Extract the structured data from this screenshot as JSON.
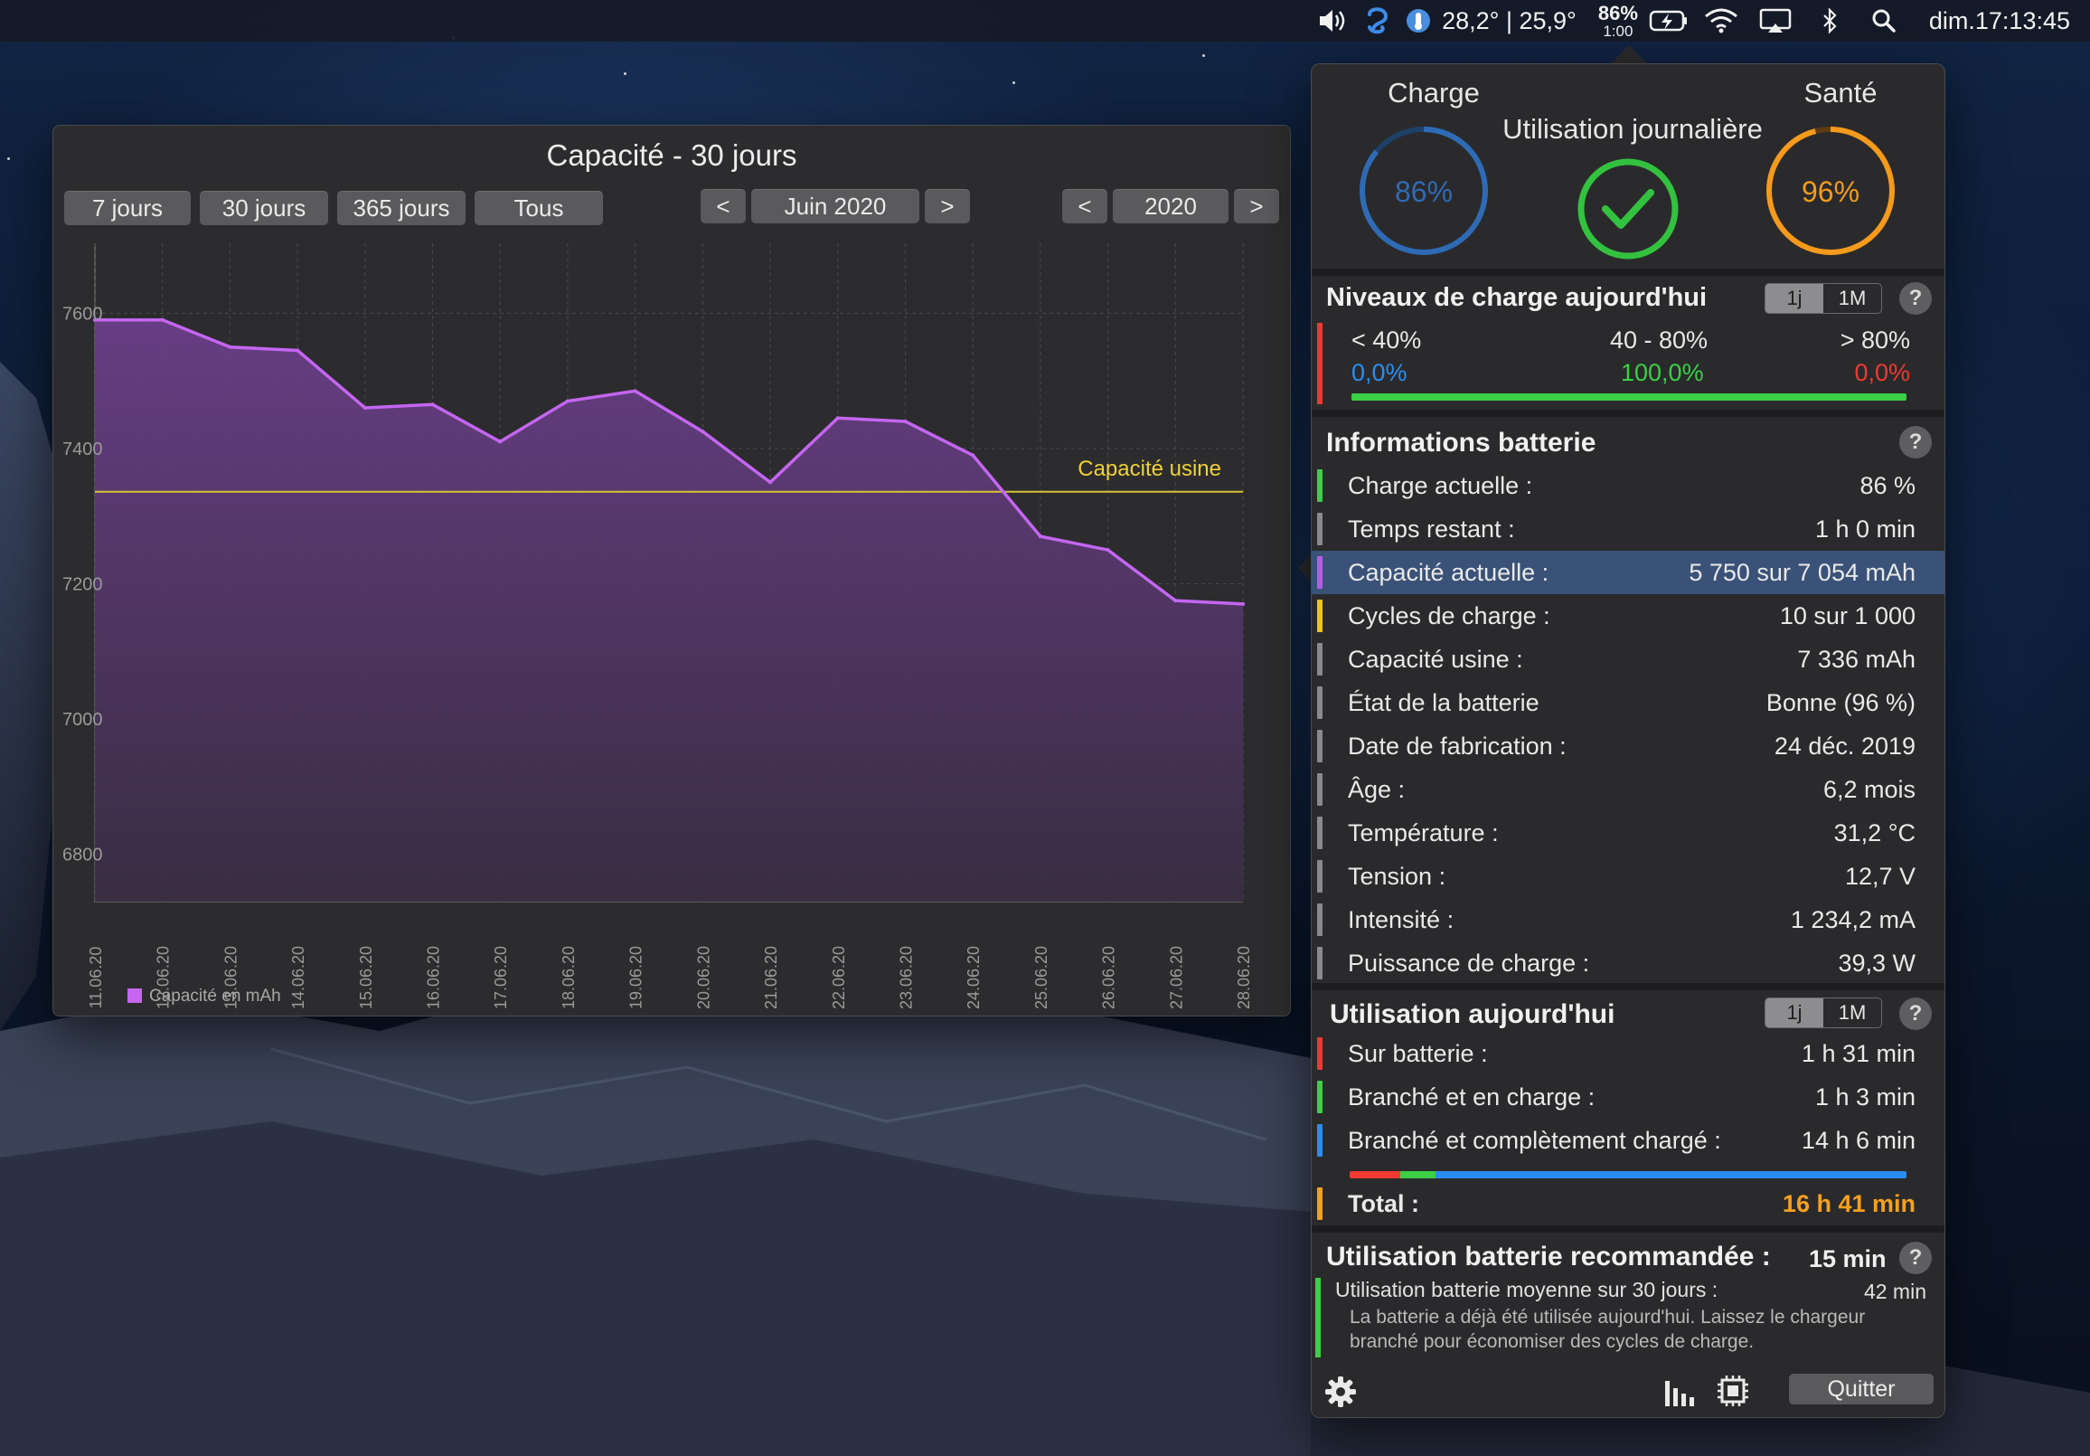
{
  "menubar": {
    "weather": "28,2° | 25,9°",
    "battery_percent": "86%",
    "battery_time": "1:00",
    "clock": "dim.17:13:45"
  },
  "history": {
    "title": "Capacité - 30 jours",
    "range_buttons": [
      "7 jours",
      "30 jours",
      "365 jours",
      "Tous"
    ],
    "month_nav": {
      "prev": "<",
      "label": "Juin 2020",
      "next": ">"
    },
    "year_nav": {
      "prev": "<",
      "label": "2020",
      "next": ">"
    },
    "legend": "Capacité en mAh",
    "reference_label": "Capacité usine"
  },
  "chart_data": {
    "type": "area",
    "x": [
      "11.06.20",
      "12.06.20",
      "13.06.20",
      "14.06.20",
      "15.06.20",
      "16.06.20",
      "17.06.20",
      "18.06.20",
      "19.06.20",
      "20.06.20",
      "21.06.20",
      "22.06.20",
      "23.06.20",
      "24.06.20",
      "25.06.20",
      "26.06.20",
      "27.06.20",
      "28.06.20"
    ],
    "series": [
      {
        "name": "Capacité en mAh",
        "values": [
          7590,
          7590,
          7550,
          7545,
          7460,
          7465,
          7410,
          7470,
          7485,
          7425,
          7350,
          7445,
          7440,
          7390,
          7270,
          7250,
          7175,
          7170
        ]
      }
    ],
    "reference_line": {
      "label": "Capacité usine",
      "value": 7336
    },
    "yticks": [
      6800,
      7000,
      7200,
      7400,
      7600
    ],
    "ylim": [
      6730,
      7690
    ],
    "grid": true,
    "legend_position": "bottom-left",
    "colors": {
      "line": "#c466f0",
      "fill": "#5e3a78",
      "reference": "#d9c23a"
    }
  },
  "popover": {
    "gauges": {
      "charge": {
        "title": "Charge",
        "value": "86%",
        "fraction": 0.86,
        "color": "#2f6bb5"
      },
      "daily": {
        "title": "Utilisation journalière",
        "color": "#33c23f"
      },
      "health": {
        "title": "Santé",
        "value": "96%",
        "fraction": 0.96,
        "color": "#f49a1c"
      }
    },
    "levels": {
      "title": "Niveaux de charge aujourd'hui",
      "seg": [
        "1j",
        "1M"
      ],
      "help": "?",
      "low": {
        "label": "< 40%",
        "value": "0,0%",
        "color": "#2a8cf0"
      },
      "mid": {
        "label": "40 - 80%",
        "value": "100,0%",
        "color": "#3ccf47"
      },
      "high": {
        "label": "> 80%",
        "value": "0,0%",
        "color": "#ee3a30"
      }
    },
    "info": {
      "title": "Informations batterie",
      "help": "?",
      "rows": [
        {
          "label": "Charge actuelle :",
          "value": "86 %",
          "color": "#3ccf47"
        },
        {
          "label": "Temps restant :",
          "value": "1 h 0 min",
          "color": "#8a8a8c"
        },
        {
          "label": "Capacité actuelle :",
          "value": "5 750 sur 7 054 mAh",
          "color": "#b35de8"
        },
        {
          "label": "Cycles de charge :",
          "value": "10 sur 1 000",
          "color": "#f0c419"
        },
        {
          "label": "Capacité usine :",
          "value": "7 336 mAh",
          "color": "#8a8a8c"
        },
        {
          "label": "État de la batterie",
          "value": "Bonne (96 %)",
          "color": "#8a8a8c"
        },
        {
          "label": "Date de fabrication :",
          "value": "24 déc. 2019",
          "color": "#8a8a8c"
        },
        {
          "label": "Âge :",
          "value": "6,2 mois",
          "color": "#8a8a8c"
        },
        {
          "label": "Température :",
          "value": "31,2 °C",
          "color": "#8a8a8c"
        },
        {
          "label": "Tension :",
          "value": "12,7 V",
          "color": "#8a8a8c"
        },
        {
          "label": "Intensité :",
          "value": "1 234,2 mA",
          "color": "#8a8a8c"
        },
        {
          "label": "Puissance de charge :",
          "value": "39,3 W",
          "color": "#8a8a8c"
        }
      ]
    },
    "usage": {
      "title": "Utilisation aujourd'hui",
      "seg": [
        "1j",
        "1M"
      ],
      "help": "?",
      "rows": [
        {
          "label": "Sur batterie :",
          "value": "1 h 31 min",
          "color": "#ee3a30"
        },
        {
          "label": "Branché et en charge :",
          "value": "1 h 3 min",
          "color": "#3ccf47"
        },
        {
          "label": "Branché et complètement chargé :",
          "value": "14 h 6 min",
          "color": "#2a8cf0"
        }
      ],
      "total_label": "Total :",
      "total_value": "16 h 41 min",
      "total_color": "#f4a020"
    },
    "recommended": {
      "title": "Utilisation batterie recommandée :",
      "value": "15 min",
      "help": "?",
      "avg_label": "Utilisation batterie moyenne sur 30 jours :",
      "avg_value": "42 min",
      "note": "La batterie a déjà été utilisée aujourd'hui. Laissez le chargeur branché pour économiser des cycles de charge."
    },
    "footer": {
      "quit": "Quitter"
    }
  }
}
